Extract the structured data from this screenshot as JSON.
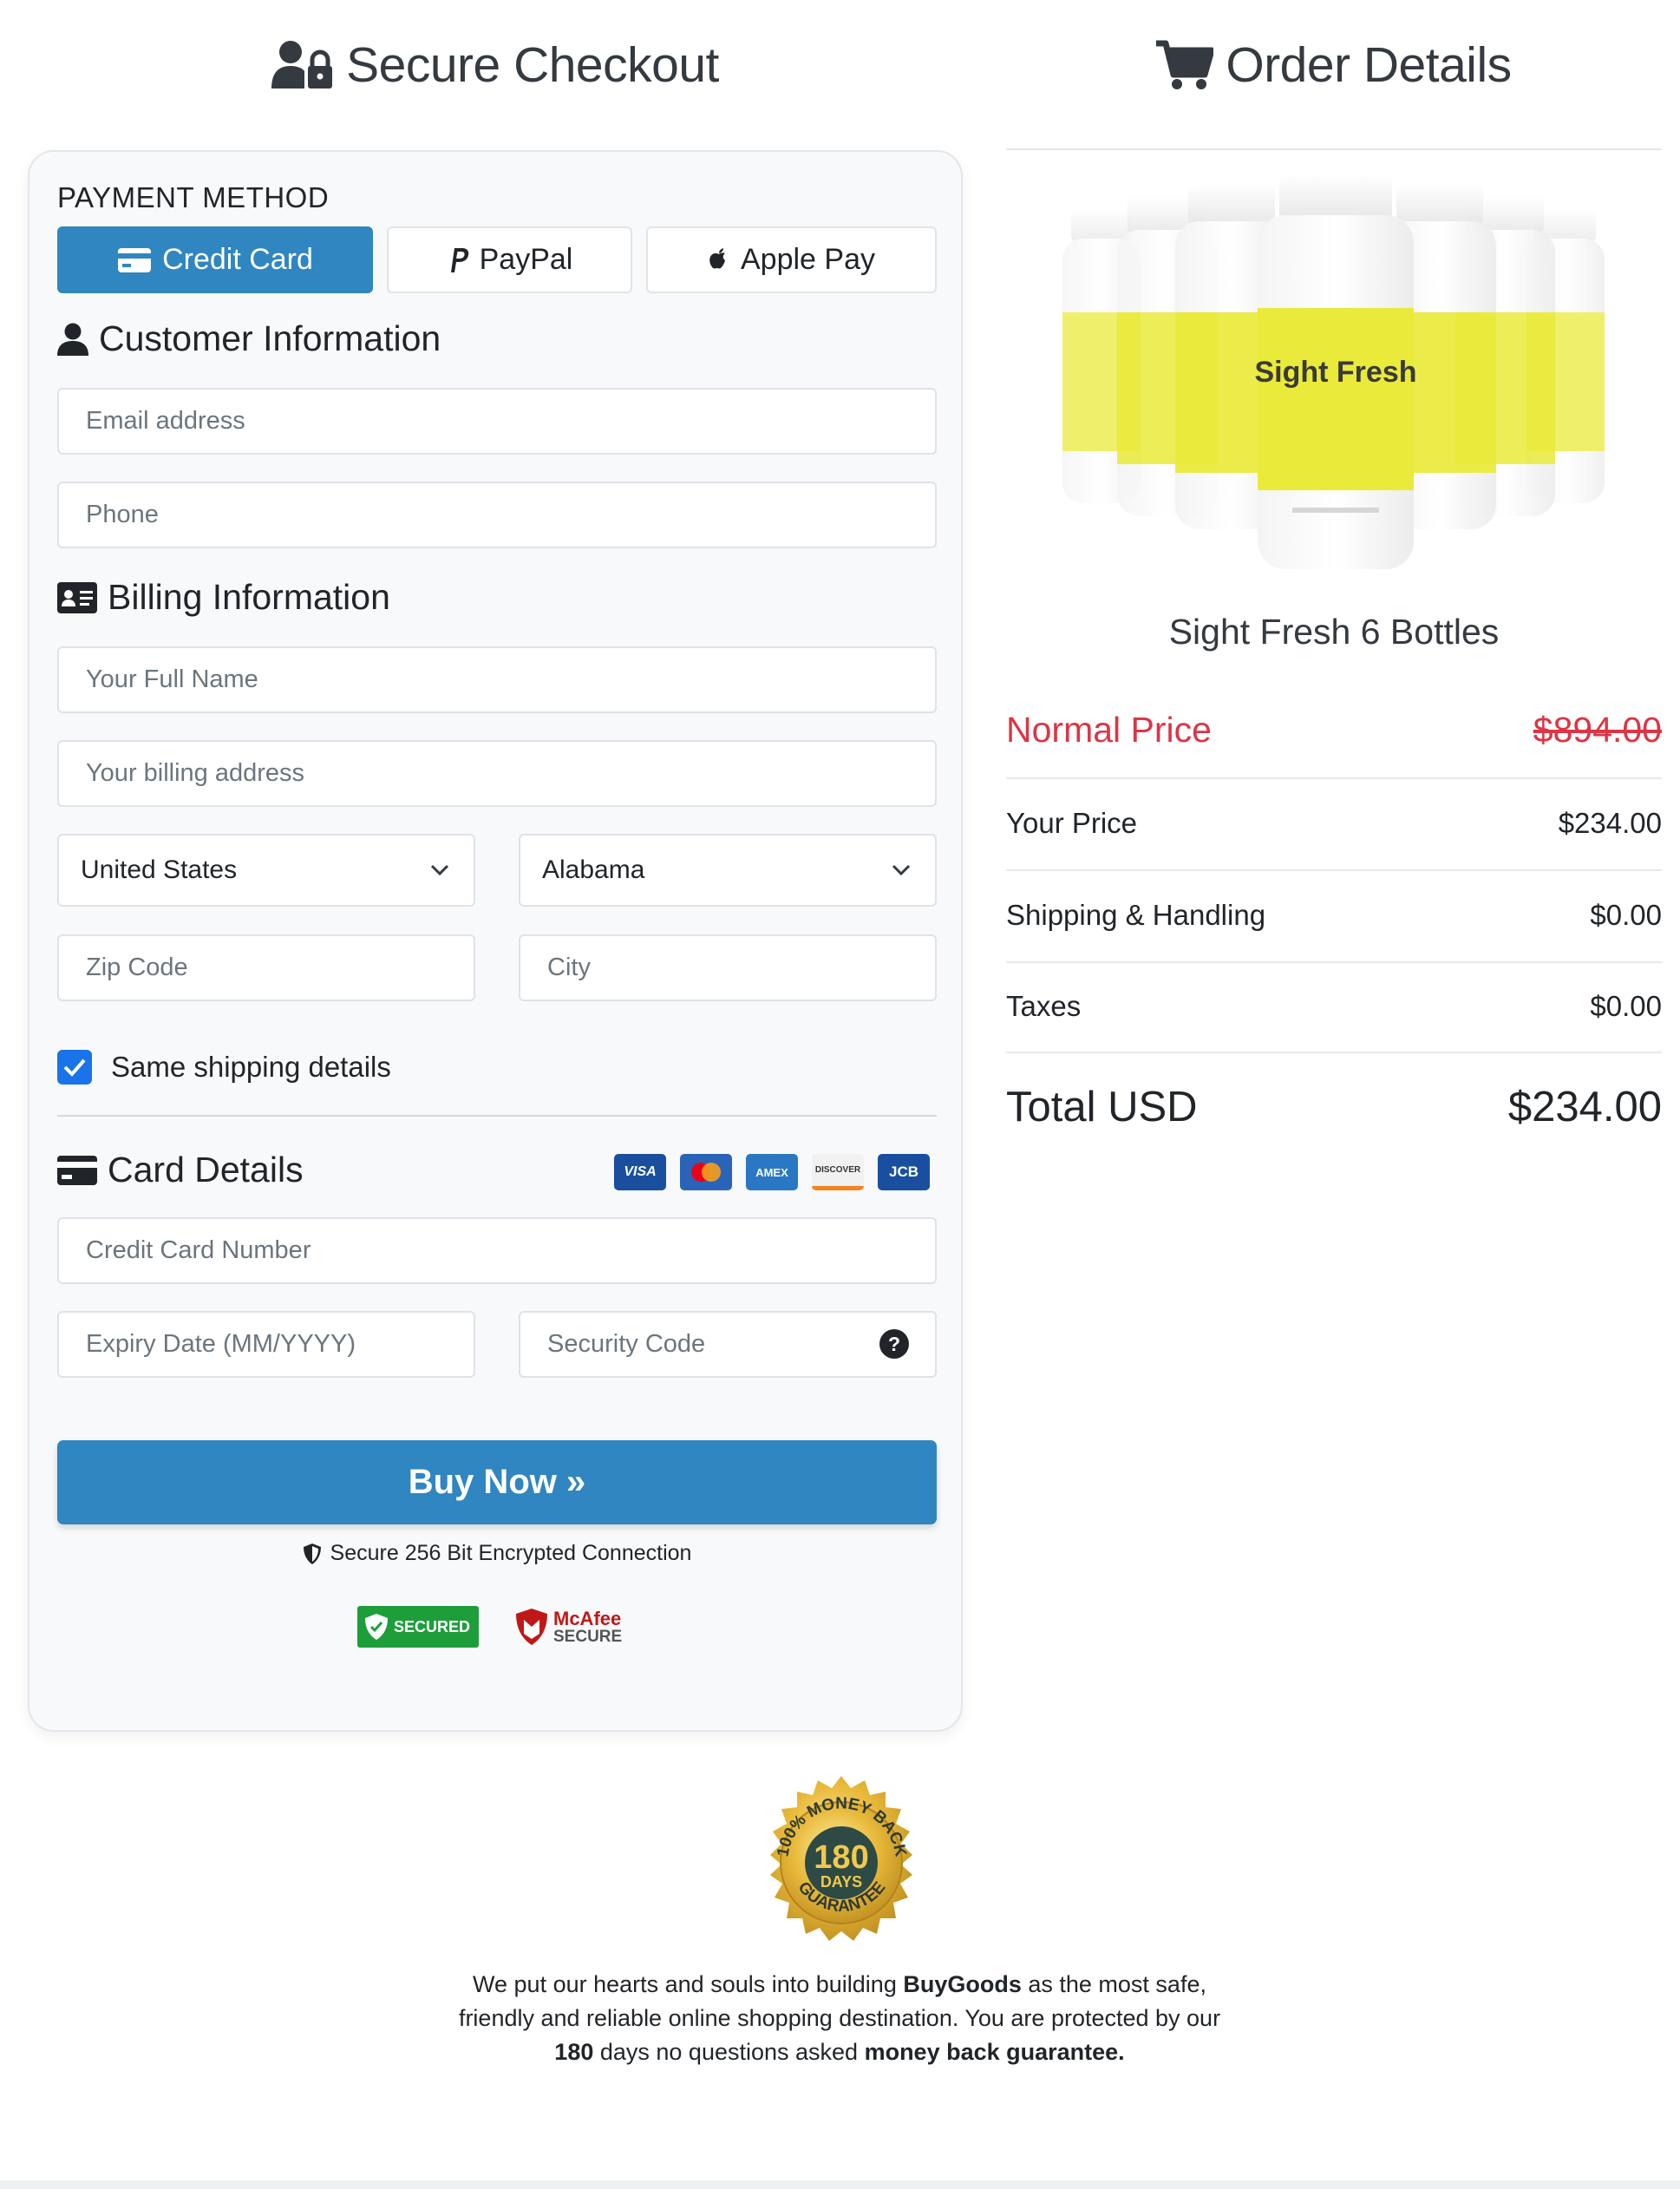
{
  "checkout": {
    "title": "Secure Checkout",
    "payment_method_label": "PAYMENT METHOD",
    "tabs": [
      {
        "label": "Credit Card",
        "icon": "credit-card-icon",
        "active": true
      },
      {
        "label": "PayPal",
        "icon": "paypal-icon",
        "active": false
      },
      {
        "label": "Apple Pay",
        "icon": "apple-icon",
        "active": false
      }
    ],
    "customer_info": {
      "heading": "Customer Information",
      "email_placeholder": "Email address",
      "phone_placeholder": "Phone"
    },
    "billing_info": {
      "heading": "Billing Information",
      "full_name_placeholder": "Your Full Name",
      "address_placeholder": "Your billing address",
      "country": "United States",
      "state": "Alabama",
      "zip_placeholder": "Zip Code",
      "city_placeholder": "City",
      "same_shipping_label": "Same shipping details",
      "same_shipping_checked": true
    },
    "card_details": {
      "heading": "Card Details",
      "logos": [
        "VISA",
        "MasterCard",
        "AMEX",
        "DISCOVER",
        "JCB"
      ],
      "card_number_placeholder": "Credit Card Number",
      "expiry_placeholder": "Expiry Date (MM/YYYY)",
      "security_code_placeholder": "Security Code"
    },
    "buy_button": "Buy Now »",
    "secure_text": "Secure 256 Bit Encrypted Connection",
    "trust_badges": {
      "secured": "SECURED",
      "mcafee_top": "McAfee",
      "mcafee_bottom": "SECURE"
    }
  },
  "order": {
    "title": "Order Details",
    "product_name": "Sight Fresh 6 Bottles",
    "bottle_label": "Sight Fresh",
    "normal_price_label": "Normal Price",
    "normal_price": "$894.00",
    "your_price_label": "Your Price",
    "your_price": "$234.00",
    "shipping_label": "Shipping & Handling",
    "shipping": "$0.00",
    "taxes_label": "Taxes",
    "taxes": "$0.00",
    "total_label": "Total USD",
    "total": "$234.00"
  },
  "guarantee": {
    "seal_top": "100% MONEY BACK",
    "seal_number": "180",
    "seal_days": "DAYS",
    "seal_bottom": "GUARANTEE",
    "text_1": "We put our hearts and souls into building ",
    "text_brand": "BuyGoods",
    "text_2": " as the most safe, friendly and reliable online shopping destination. You are protected by our ",
    "text_days": "180",
    "text_3": " days no questions asked ",
    "text_guarantee": "money back guarantee."
  },
  "colors": {
    "primary": "#2f86c1",
    "normal_price": "#dc3545",
    "bottle_yellow": "#eaea3a"
  }
}
